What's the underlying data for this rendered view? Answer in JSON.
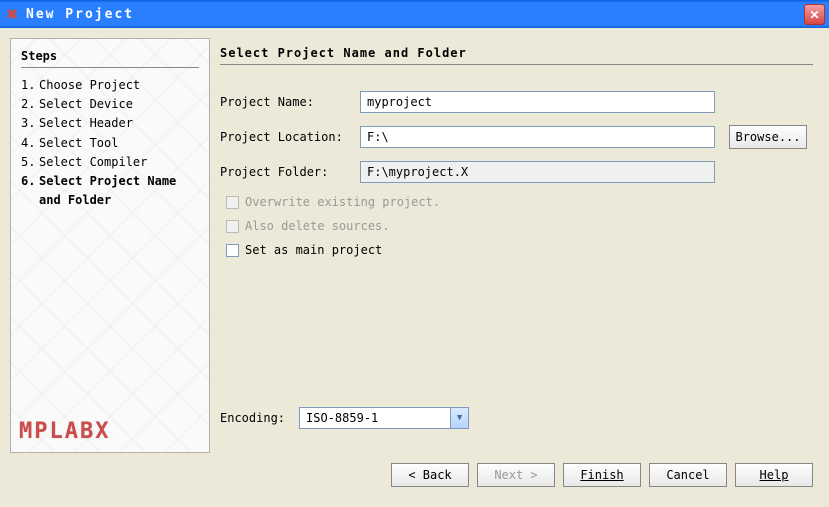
{
  "window": {
    "title": "New Project"
  },
  "sidebar": {
    "heading": "Steps",
    "items": [
      {
        "num": "1.",
        "label": "Choose Project"
      },
      {
        "num": "2.",
        "label": "Select Device"
      },
      {
        "num": "3.",
        "label": "Select Header"
      },
      {
        "num": "4.",
        "label": "Select Tool"
      },
      {
        "num": "5.",
        "label": "Select Compiler"
      },
      {
        "num": "6.",
        "label": "Select Project Name and Folder"
      }
    ],
    "logo": "MPLABX"
  },
  "main": {
    "heading": "Select Project Name and Folder",
    "fields": {
      "name_label": "Project Name:",
      "name_value": "myproject",
      "location_label": "Project Location:",
      "location_value": "F:\\",
      "browse_label": "Browse...",
      "folder_label": "Project Folder:",
      "folder_value": "F:\\myproject.X"
    },
    "checks": {
      "overwrite": "Overwrite existing project.",
      "delete_sources": "Also delete sources.",
      "set_main": "Set as main project"
    },
    "encoding": {
      "label": "Encoding:",
      "value": "ISO-8859-1"
    }
  },
  "buttons": {
    "back": "< Back",
    "next": "Next >",
    "finish": "Finish",
    "cancel": "Cancel",
    "help": "Help"
  }
}
